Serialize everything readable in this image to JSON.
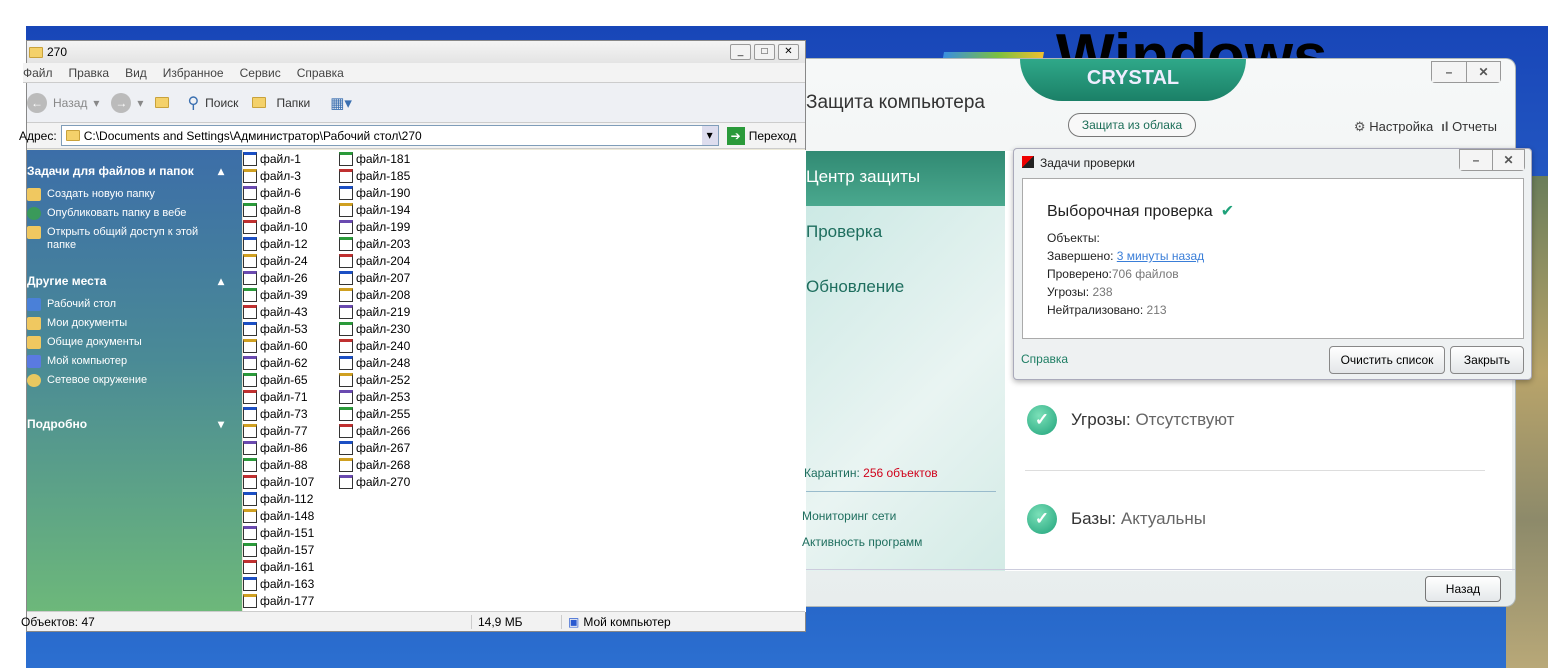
{
  "wallpaper": {
    "logo_text": "Windows"
  },
  "explorer": {
    "title": "270",
    "menu": [
      "Файл",
      "Правка",
      "Вид",
      "Избранное",
      "Сервис",
      "Справка"
    ],
    "toolbar": {
      "back": "Назад",
      "search": "Поиск",
      "folders": "Папки"
    },
    "address": {
      "label": "Адрес:",
      "value": "C:\\Documents and Settings\\Администратор\\Рабочий стол\\270",
      "go": "Переход"
    },
    "left_pane": {
      "tasks_title": "Задачи для файлов и папок",
      "tasks": [
        "Создать новую папку",
        "Опубликовать папку в вебе",
        "Открыть общий доступ к этой папке"
      ],
      "places_title": "Другие места",
      "places": [
        "Рабочий стол",
        "Мои документы",
        "Общие документы",
        "Мой компьютер",
        "Сетевое окружение"
      ],
      "details_title": "Подробно"
    },
    "files_col1": [
      "файл-1",
      "файл-3",
      "файл-6",
      "файл-8",
      "файл-10",
      "файл-12",
      "файл-24",
      "файл-26",
      "файл-39",
      "файл-43",
      "файл-53",
      "файл-60",
      "файл-62",
      "файл-65",
      "файл-71",
      "файл-73",
      "файл-77",
      "файл-86",
      "файл-88",
      "файл-107",
      "файл-112",
      "файл-148",
      "файл-151",
      "файл-157",
      "файл-161",
      "файл-163",
      "файл-177"
    ],
    "files_col2": [
      "файл-181",
      "файл-185",
      "файл-190",
      "файл-194",
      "файл-199",
      "файл-203",
      "файл-204",
      "файл-207",
      "файл-208",
      "файл-219",
      "файл-230",
      "файл-240",
      "файл-248",
      "файл-252",
      "файл-253",
      "файл-255",
      "файл-266",
      "файл-267",
      "файл-268",
      "файл-270"
    ],
    "status": {
      "objects": "Объектов: 47",
      "size": "14,9 МБ",
      "location": "Мой компьютер"
    }
  },
  "kaspersky": {
    "brand": "CRYSTAL",
    "title": "Защита компьютера",
    "cloud_button": "Защита из облака",
    "settings": "Настройка",
    "reports": "Отчеты",
    "nav": [
      "Центр защиты",
      "Проверка",
      "Обновление"
    ],
    "quarantine_label": "Карантин:",
    "quarantine_value": "256 объектов",
    "links": [
      "Мониторинг сети",
      "Активность программ"
    ],
    "statuses": [
      {
        "label": "Угрозы:",
        "value": "Отсутствуют"
      },
      {
        "label": "Базы:",
        "value": "Актуальны"
      }
    ],
    "back_button": "Назад",
    "accent": "#1fa27a"
  },
  "dialog": {
    "title": "Задачи проверки",
    "heading": "Выборочная проверка",
    "objects_label": "Объекты:",
    "completed_label": "Завершено:",
    "completed_value": "3 минуты назад",
    "scanned_label": "Проверено:",
    "scanned_value": "706 файлов",
    "threats_label": "Угрозы:",
    "threats_value": "238",
    "neutralized_label": "Нейтрализовано:",
    "neutralized_value": "213",
    "help": "Справка",
    "clear_button": "Очистить список",
    "close_button": "Закрыть"
  }
}
